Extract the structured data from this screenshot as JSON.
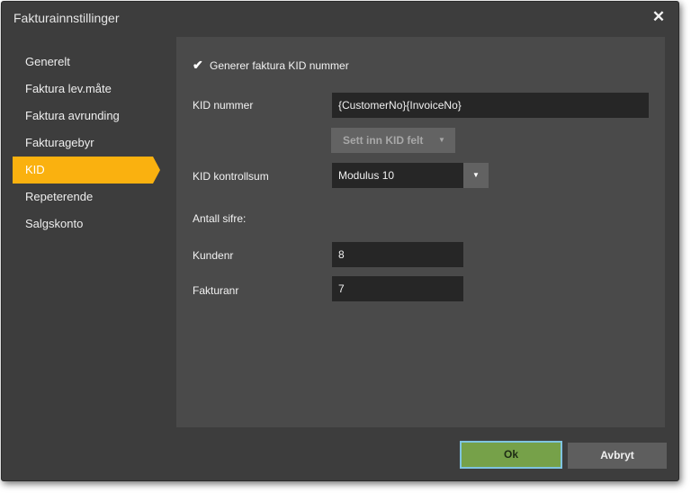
{
  "window": {
    "title": "Fakturainnstillinger",
    "close_icon": "close-icon",
    "close_glyph": "✕"
  },
  "sidebar": {
    "items": [
      {
        "label": "Generelt",
        "active": false
      },
      {
        "label": "Faktura lev.måte",
        "active": false
      },
      {
        "label": "Faktura avrunding",
        "active": false
      },
      {
        "label": "Fakturagebyr",
        "active": false
      },
      {
        "label": "KID",
        "active": true
      },
      {
        "label": "Repeterende",
        "active": false
      },
      {
        "label": "Salgskonto",
        "active": false
      }
    ],
    "active_color": "#fab10f"
  },
  "kid": {
    "generate_checkbox": {
      "label": "Generer faktura KID nummer",
      "checked": true,
      "glyph": "✔"
    },
    "kid_number": {
      "label": "KID nummer",
      "value": "{CustomerNo}{InvoiceNo}"
    },
    "insert_button": {
      "label": "Sett inn KID felt",
      "caret": "▼",
      "enabled": false
    },
    "checksum": {
      "label": "KID kontrollsum",
      "value": "Modulus 10",
      "caret": "▼"
    },
    "digits_heading": "Antall sifre:",
    "customer_number": {
      "label": "Kundenr",
      "value": "8"
    },
    "invoice_number": {
      "label": "Fakturanr",
      "value": "7"
    }
  },
  "footer": {
    "ok_label": "Ok",
    "cancel_label": "Avbryt",
    "ok_color": "#76a149"
  }
}
